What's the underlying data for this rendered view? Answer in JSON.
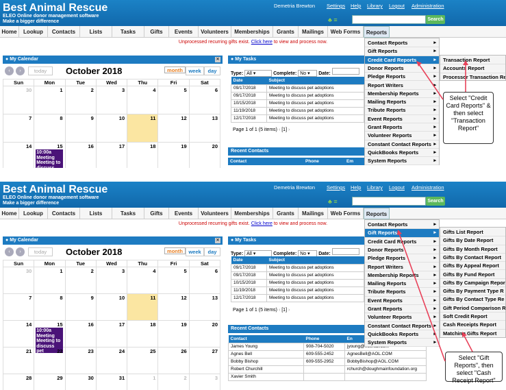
{
  "app": {
    "brand_title": "Best Animal Rescue",
    "brand_sub1": "ELEO Online donor management software",
    "brand_sub2": "Make a bigger difference",
    "user": "Demetria Brewton",
    "links": [
      "Settings",
      "Help",
      "Library",
      "Logout",
      "Administration"
    ],
    "search_button": "Search"
  },
  "nav": [
    "Home",
    "Lookup",
    "Contacts",
    "Lists",
    "Tasks",
    "Gifts",
    "Events",
    "Volunteers",
    "Memberships",
    "Grants",
    "Mailings",
    "Web Forms",
    "Reports"
  ],
  "notice": {
    "prefix": "Unprocessed recurring gifts exist.",
    "link": "Click here",
    "suffix": "to view and process now."
  },
  "calendar": {
    "panel_title": "My Calendar",
    "today": "today",
    "month_title": "October 2018",
    "views": [
      "month",
      "week",
      "day"
    ],
    "days": [
      "Sun",
      "Mon",
      "Tue",
      "Wed",
      "Thu",
      "Fri",
      "Sat"
    ],
    "weeks1": [
      [
        "30",
        "1",
        "2",
        "3",
        "4",
        "5",
        "6"
      ],
      [
        "7",
        "8",
        "9",
        "10",
        "11",
        "12",
        "13"
      ],
      [
        "14",
        "15",
        "16",
        "17",
        "18",
        "19",
        "20"
      ]
    ],
    "weeks2": [
      [
        "30",
        "1",
        "2",
        "3",
        "4",
        "5",
        "6"
      ],
      [
        "7",
        "8",
        "9",
        "10",
        "11",
        "12",
        "13"
      ],
      [
        "14",
        "15",
        "16",
        "17",
        "18",
        "19",
        "20"
      ],
      [
        "21",
        "22",
        "23",
        "24",
        "25",
        "26",
        "27"
      ],
      [
        "28",
        "29",
        "30",
        "31",
        "1",
        "2",
        "3"
      ]
    ],
    "event1": "10:00a Meeting Meeting to discuss pet",
    "event2": "10:00a Meeting Meeting to discuss pet adoptions"
  },
  "tasks": {
    "panel_title": "My Tasks",
    "type_label": "Type:",
    "type_value": "All",
    "complete_label": "Complete:",
    "complete_value": "No",
    "date_label": "Date:",
    "columns": [
      "Date",
      "Subject"
    ],
    "rows": [
      [
        "09/17/2018",
        "Meeting to discuss pet adoptions"
      ],
      [
        "09/17/2018",
        "Meeting to discuss pet adoptions"
      ],
      [
        "10/15/2018",
        "Meeting to discuss pet adoptions"
      ],
      [
        "11/19/2018",
        "Meeting to discuss pet adoptions"
      ],
      [
        "12/17/2018",
        "Meeting to discuss pet adoptions"
      ]
    ],
    "pager": "Page 1 of 1 (5 items)",
    "page": "[1]"
  },
  "recent": {
    "title": "Recent Contacts",
    "columns": [
      "Contact",
      "Phone",
      "Em"
    ],
    "columns2": [
      "Contact",
      "Phone",
      "En"
    ],
    "rows": [
      [
        "James Young",
        "908-704-5020",
        "jyoung@hotmail.com"
      ],
      [
        "Agnes Bell",
        "609-555-2452",
        "AgnesBell@AOL.COM"
      ],
      [
        "Bobby Bishop",
        "609-555-2952",
        "BobbyBishop@AOL.COM"
      ],
      [
        "Robert Churchill",
        "",
        "rchurch@doughmainfoundation.org"
      ],
      [
        "Xavier Smith",
        "",
        ""
      ]
    ]
  },
  "reports_menu": [
    "Contact Reports",
    "Gift Reports",
    "Credit Card Reports",
    "Donor Reports",
    "Pledge Reports",
    "Report Writers",
    "Membership Reports",
    "Mailing Reports",
    "Tribute Reports",
    "Event Reports",
    "Grant Reports",
    "Volunteer Reports",
    "Constant Contact Reports",
    "QuickBooks Reports",
    "System Reports"
  ],
  "credit_card_submenu": [
    "Transaction Report",
    "Accounts Report",
    "Processor Transaction Re"
  ],
  "gift_submenu": [
    "Gifts List Report",
    "Gifts By Date Report",
    "Gifts By Month Report",
    "Gifts By Contact Report",
    "Gifts By Appeal Report",
    "Gifts By Fund Report",
    "Gifts By Campaign Repor",
    "Gifts By Payment Type R",
    "Gifts By Contact Type Re",
    "Gift Period Comparison R",
    "Soft Credit Report",
    "Cash Receipts Report",
    "Matching Gifts Report"
  ],
  "callout1": "Select \"Credit Card Reports\" & then select \"Transaction Report\"",
  "callout2": "Select \"Gift Reports\", then select \"Cash Receipt Report\"",
  "colors": {
    "header": "#1b82c6",
    "accent": "#1d7bc1",
    "event": "#4a1378",
    "today": "#fbe6a2",
    "arrow": "#e8425a"
  }
}
